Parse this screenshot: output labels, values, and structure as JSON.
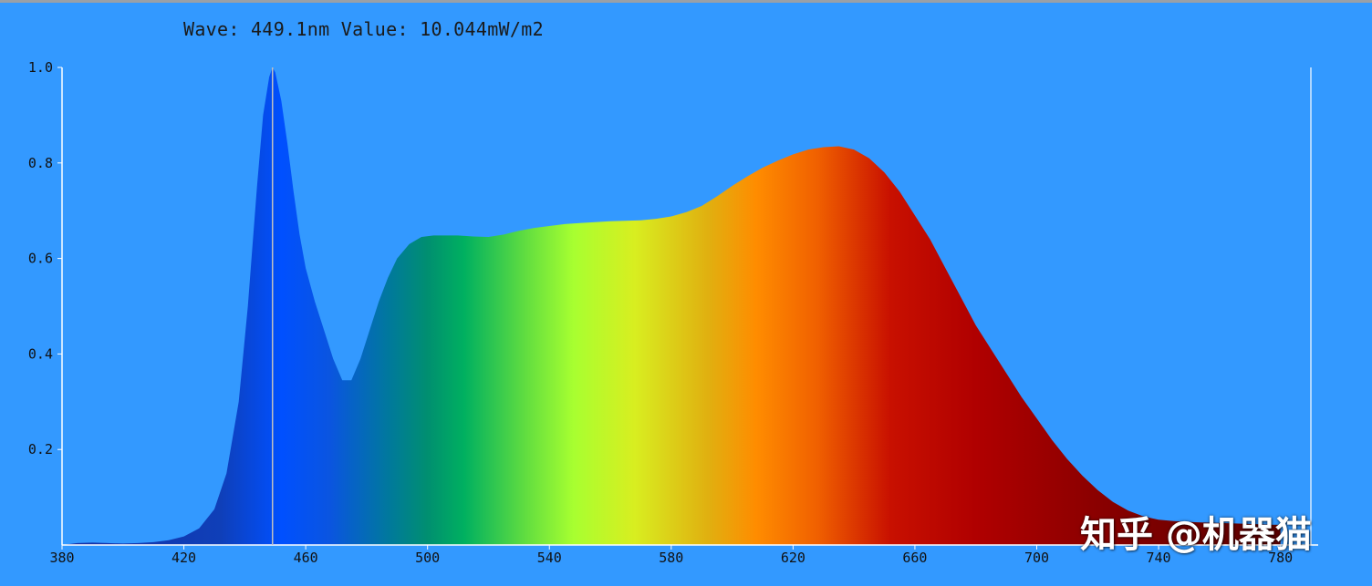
{
  "readout": {
    "text": "Wave: 449.1nm Value: 10.044mW/m2"
  },
  "watermark": {
    "text": "知乎 @机器猫"
  },
  "colors": {
    "background": "#3399FF",
    "axis": "#ffffff",
    "cursor": "#c0c0c0"
  },
  "chart_data": {
    "type": "area",
    "title": "",
    "xlabel": "",
    "ylabel": "",
    "xlim": [
      380,
      790
    ],
    "ylim": [
      0,
      1.0
    ],
    "xticks": [
      "380",
      "420",
      "460",
      "500",
      "540",
      "580",
      "620",
      "660",
      "700",
      "740",
      "780"
    ],
    "yticks": [
      "0.2",
      "0.4",
      "0.6",
      "0.8",
      "1.0"
    ],
    "cursor_wavelength": 449.1,
    "fill": "spectral-gradient",
    "grid": false,
    "series": [
      {
        "x": [
          380,
          385,
          390,
          395,
          400,
          405,
          410,
          415,
          420,
          425,
          430,
          434,
          438,
          441,
          444,
          446,
          448,
          449.1,
          450,
          452,
          454,
          456,
          458,
          460,
          463,
          466,
          469,
          472,
          475,
          478,
          481,
          484,
          487,
          490,
          494,
          498,
          502,
          506,
          510,
          515,
          520,
          525,
          530,
          535,
          540,
          545,
          550,
          555,
          560,
          565,
          570,
          575,
          580,
          585,
          590,
          595,
          600,
          605,
          610,
          615,
          620,
          625,
          630,
          635,
          640,
          645,
          650,
          655,
          660,
          665,
          670,
          675,
          680,
          685,
          690,
          695,
          700,
          705,
          710,
          715,
          720,
          725,
          730,
          735,
          740,
          745,
          750,
          755,
          760,
          765,
          770,
          775,
          780
        ],
        "y": [
          0.0,
          0.004,
          0.005,
          0.004,
          0.003,
          0.004,
          0.006,
          0.01,
          0.018,
          0.035,
          0.075,
          0.15,
          0.3,
          0.5,
          0.75,
          0.9,
          0.98,
          1.0,
          0.99,
          0.93,
          0.84,
          0.74,
          0.65,
          0.58,
          0.51,
          0.45,
          0.39,
          0.345,
          0.345,
          0.39,
          0.45,
          0.51,
          0.56,
          0.6,
          0.63,
          0.645,
          0.648,
          0.648,
          0.648,
          0.646,
          0.645,
          0.65,
          0.658,
          0.664,
          0.668,
          0.672,
          0.674,
          0.676,
          0.678,
          0.679,
          0.68,
          0.683,
          0.688,
          0.697,
          0.71,
          0.73,
          0.752,
          0.772,
          0.79,
          0.805,
          0.818,
          0.828,
          0.833,
          0.835,
          0.828,
          0.81,
          0.78,
          0.74,
          0.69,
          0.64,
          0.58,
          0.52,
          0.46,
          0.41,
          0.36,
          0.31,
          0.265,
          0.22,
          0.18,
          0.145,
          0.115,
          0.09,
          0.072,
          0.06,
          0.053,
          0.05,
          0.048,
          0.047,
          0.046,
          0.045,
          0.044,
          0.043,
          0.042
        ]
      }
    ]
  }
}
